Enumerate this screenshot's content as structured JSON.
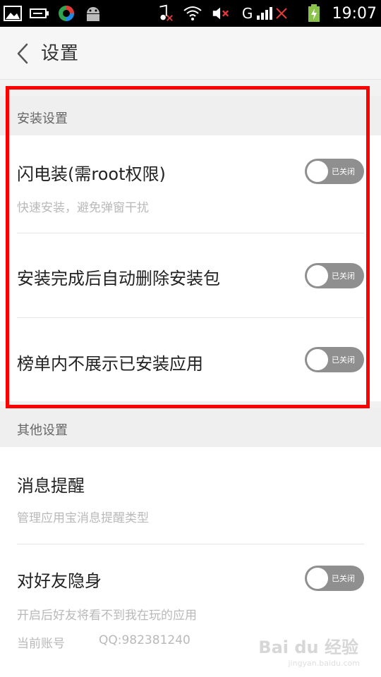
{
  "status_bar": {
    "time": "19:07",
    "network_label": "G",
    "left_icons": [
      "image-icon",
      "usb-icon",
      "app-icon",
      "android-icon"
    ],
    "right_icons": [
      "music-muted-icon",
      "wifi-icon",
      "volume-muted-icon",
      "signal-icon",
      "battery-charging-icon"
    ]
  },
  "header": {
    "title": "设置"
  },
  "sections": {
    "install": {
      "header": "安装设置",
      "items": [
        {
          "title": "闪电装(需root权限)",
          "subtitle": "快速安装，避免弹窗干扰",
          "toggle_label": "已关闭"
        },
        {
          "title": "安装完成后自动删除安装包",
          "toggle_label": "已关闭"
        },
        {
          "title": "榜单内不展示已安装应用",
          "toggle_label": "已关闭"
        }
      ]
    },
    "other": {
      "header": "其他设置",
      "items": [
        {
          "title": "消息提醒",
          "subtitle": "管理应用宝消息提醒类型"
        },
        {
          "title": "对好友隐身",
          "subtitle": "开启后好友将看不到我在玩的应用",
          "account_label": "当前账号",
          "account_value": "QQ:982381240",
          "toggle_label": "已关闭"
        }
      ]
    }
  },
  "watermark": {
    "text": "Bai du 经验",
    "sub": "jingyan.baidu.com"
  },
  "colors": {
    "highlight": "#ff0000",
    "toggle_off": "#8f8f8f"
  }
}
